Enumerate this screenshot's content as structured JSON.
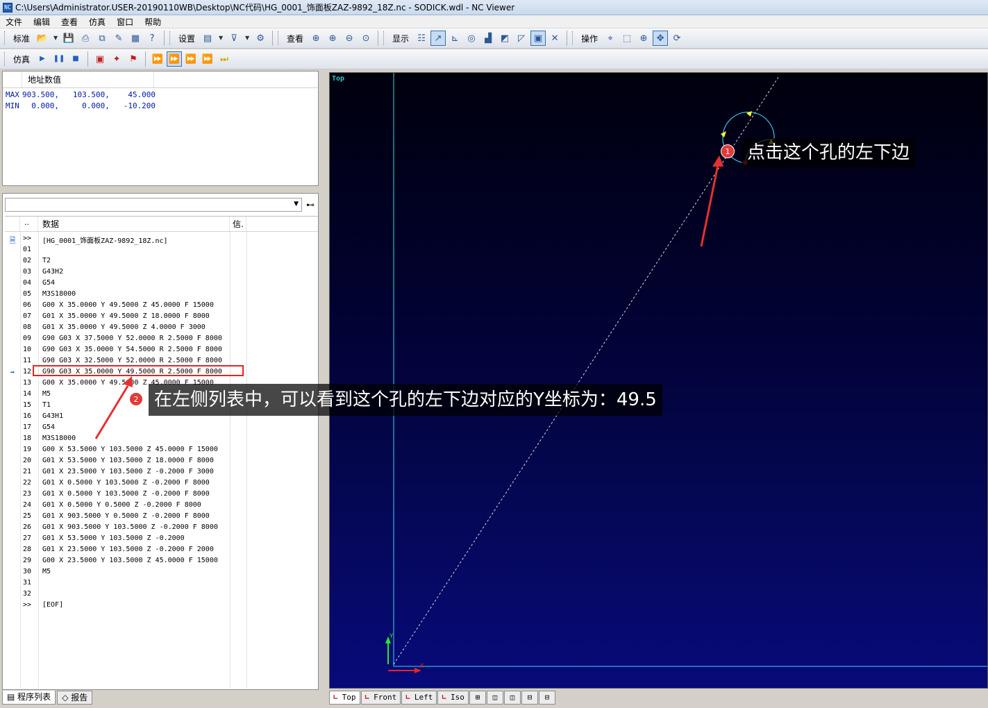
{
  "window": {
    "title": "C:\\Users\\Administrator.USER-20190110WB\\Desktop\\NC代码\\HG_0001_饰面板ZAZ-9892_18Z.nc - SODICK.wdl - NC Viewer",
    "icon_text": "NC"
  },
  "menu": [
    "文件",
    "编辑",
    "查看",
    "仿真",
    "窗口",
    "帮助"
  ],
  "toolbar1": {
    "groups": [
      {
        "label": "标准",
        "icons": [
          "open-folder-icon",
          "save-icon",
          "print-icon",
          "copy-icon",
          "edit-icon",
          "machine-icon",
          "help-icon"
        ]
      },
      {
        "label": "设置",
        "icons": [
          "grid-icon",
          "filter-icon",
          "config-icon"
        ]
      },
      {
        "label": "查看",
        "icons": [
          "zoom-window-icon",
          "zoom-in-icon",
          "zoom-out-icon",
          "zoom-fit-icon"
        ]
      },
      {
        "label": "显示",
        "icons": [
          "list-view-icon",
          "toolpath-icon",
          "axes-icon",
          "camera-icon",
          "tool-icon",
          "plane-icon",
          "corner-icon",
          "frame-icon",
          "delete-icon"
        ]
      },
      {
        "label": "操作",
        "icons": [
          "measure-icon",
          "select-icon",
          "zoom-icon",
          "pan-icon",
          "rotate-icon"
        ]
      }
    ],
    "glyphs": {
      "open-folder-icon": "📂",
      "save-icon": "💾",
      "print-icon": "⎙",
      "copy-icon": "⧉",
      "edit-icon": "✎",
      "machine-icon": "▦",
      "help-icon": "?",
      "grid-icon": "▤",
      "filter-icon": "⊽",
      "config-icon": "⚙",
      "zoom-window-icon": "⊕",
      "zoom-in-icon": "⊕",
      "zoom-out-icon": "⊖",
      "zoom-fit-icon": "⊙",
      "list-view-icon": "☷",
      "toolpath-icon": "↗",
      "axes-icon": "⊾",
      "camera-icon": "◎",
      "tool-icon": "▟",
      "plane-icon": "◩",
      "corner-icon": "◸",
      "frame-icon": "▣",
      "delete-icon": "✕",
      "measure-icon": "⌖",
      "select-icon": "⬚",
      "zoom-icon": "⊕",
      "pan-icon": "✥",
      "rotate-icon": "⟳"
    },
    "active": [
      "toolpath-icon",
      "frame-icon",
      "pan-icon"
    ]
  },
  "toolbar2": {
    "label": "仿真",
    "icons": [
      "play-icon",
      "pause-icon",
      "stop-icon",
      "sim-option-icon",
      "sim-tool-icon",
      "sim-flag-icon",
      "step-fast-icon",
      "step-active-icon",
      "step-next-icon",
      "step-double-icon",
      "step-end-icon"
    ],
    "glyphs": {
      "play-icon": "▶",
      "pause-icon": "❚❚",
      "stop-icon": "■",
      "sim-option-icon": "▣",
      "sim-tool-icon": "✦",
      "sim-flag-icon": "⚑",
      "step-fast-icon": "⏩",
      "step-active-icon": "⏩",
      "step-next-icon": "⏩",
      "step-double-icon": "⏩",
      "step-end-icon": "⏭"
    },
    "active": [
      "step-active-icon"
    ]
  },
  "address_panel": {
    "header": "地址数值",
    "rows": [
      {
        "key": "MAX",
        "value": "903.500,   103.500,    45.000"
      },
      {
        "key": "MIN",
        "value": "  0.000,     0.000,   -10.200"
      }
    ]
  },
  "program_panel": {
    "combo_value": "",
    "header": {
      "dots": "..",
      "data": "数据",
      "info": "信."
    },
    "rows": [
      {
        "mk": "doc",
        "ln": ">>",
        "tx": "[HG_0001_饰面板ZAZ-9892_18Z.nc]"
      },
      {
        "mk": "",
        "ln": "01",
        "tx": ""
      },
      {
        "mk": "",
        "ln": "02",
        "tx": "T2"
      },
      {
        "mk": "",
        "ln": "03",
        "tx": "G43H2"
      },
      {
        "mk": "",
        "ln": "04",
        "tx": "G54"
      },
      {
        "mk": "",
        "ln": "05",
        "tx": "M3S18000"
      },
      {
        "mk": "",
        "ln": "06",
        "tx": "G00 X 35.0000 Y 49.5000 Z 45.0000 F 15000"
      },
      {
        "mk": "",
        "ln": "07",
        "tx": "G01 X 35.0000 Y 49.5000 Z 18.0000 F 8000"
      },
      {
        "mk": "",
        "ln": "08",
        "tx": "G01 X 35.0000 Y 49.5000 Z 4.0000 F 3000"
      },
      {
        "mk": "",
        "ln": "09",
        "tx": "G90 G03 X 37.5000 Y 52.0000 R 2.5000 F 8000"
      },
      {
        "mk": "",
        "ln": "10",
        "tx": "G90 G03 X 35.0000 Y 54.5000 R 2.5000 F 8000"
      },
      {
        "mk": "",
        "ln": "11",
        "tx": "G90 G03 X 32.5000 Y 52.0000 R 2.5000 F 8000"
      },
      {
        "mk": "arrow",
        "ln": "12",
        "tx": "G90 G03 X 35.0000 Y 49.5000 R 2.5000 F 8000"
      },
      {
        "mk": "",
        "ln": "13",
        "tx": "G00 X 35.0000 Y 49.5000 Z 45.0000 F 15000"
      },
      {
        "mk": "",
        "ln": "14",
        "tx": "M5"
      },
      {
        "mk": "",
        "ln": "15",
        "tx": "T1"
      },
      {
        "mk": "",
        "ln": "16",
        "tx": "G43H1"
      },
      {
        "mk": "",
        "ln": "17",
        "tx": "G54"
      },
      {
        "mk": "",
        "ln": "18",
        "tx": "M3S18000"
      },
      {
        "mk": "",
        "ln": "19",
        "tx": "G00 X 53.5000 Y 103.5000 Z 45.0000 F 15000"
      },
      {
        "mk": "",
        "ln": "20",
        "tx": "G01 X 53.5000 Y 103.5000 Z 18.0000 F 8000"
      },
      {
        "mk": "",
        "ln": "21",
        "tx": "G01 X 23.5000 Y 103.5000 Z -0.2000 F 3000"
      },
      {
        "mk": "",
        "ln": "22",
        "tx": "G01 X 0.5000 Y 103.5000 Z -0.2000 F 8000"
      },
      {
        "mk": "",
        "ln": "23",
        "tx": "G01 X 0.5000 Y 103.5000 Z -0.2000 F 8000"
      },
      {
        "mk": "",
        "ln": "24",
        "tx": "G01 X 0.5000 Y 0.5000 Z -0.2000 F 8000"
      },
      {
        "mk": "",
        "ln": "25",
        "tx": "G01 X 903.5000 Y 0.5000 Z -0.2000 F 8000"
      },
      {
        "mk": "",
        "ln": "26",
        "tx": "G01 X 903.5000 Y 103.5000 Z -0.2000 F 8000"
      },
      {
        "mk": "",
        "ln": "27",
        "tx": "G01 X 53.5000 Y 103.5000 Z -0.2000"
      },
      {
        "mk": "",
        "ln": "28",
        "tx": "G01 X 23.5000 Y 103.5000 Z -0.2000 F 2000"
      },
      {
        "mk": "",
        "ln": "29",
        "tx": "G00 X 23.5000 Y 103.5000 Z 45.0000 F 15000"
      },
      {
        "mk": "",
        "ln": "30",
        "tx": "M5"
      },
      {
        "mk": "",
        "ln": "31",
        "tx": ""
      },
      {
        "mk": "",
        "ln": "32",
        "tx": ""
      },
      {
        "mk": "",
        "ln": ">>",
        "tx": "[EOF]"
      }
    ],
    "current_line": "12"
  },
  "left_tabs": [
    {
      "label": "程序列表",
      "icon": "program-list-icon",
      "glyph": "▤",
      "active": true
    },
    {
      "label": "报告",
      "icon": "report-icon",
      "glyph": "◇",
      "active": false
    }
  ],
  "viewport": {
    "label": "Top",
    "axis_x_label": "X",
    "axis_y_label": "Y",
    "colors": {
      "frame": "#3fd6e6",
      "path": "#d8d8d8",
      "arc": "#36c7e8",
      "arrow": "#ffff33",
      "start": "#ff2020"
    }
  },
  "view_tabs": [
    {
      "label": "Top",
      "active": true
    },
    {
      "label": "Front",
      "active": false
    },
    {
      "label": "Left",
      "active": false
    },
    {
      "label": "Iso",
      "active": false
    }
  ],
  "view_layout_icons": [
    {
      "icon": "layout-quad-icon",
      "glyph": "⊞"
    },
    {
      "icon": "layout-left-icon",
      "glyph": "◫"
    },
    {
      "icon": "layout-right-icon",
      "glyph": "◫"
    },
    {
      "icon": "layout-top-icon",
      "glyph": "⊟"
    },
    {
      "icon": "layout-bottom-icon",
      "glyph": "⊟"
    }
  ],
  "annotations": {
    "callout1": {
      "badge": "1",
      "text": "点击这个孔的左下边"
    },
    "callout2": {
      "badge": "2",
      "text": "在左侧列表中，可以看到这个孔的左下边对应的Y坐标为：49.5"
    }
  }
}
